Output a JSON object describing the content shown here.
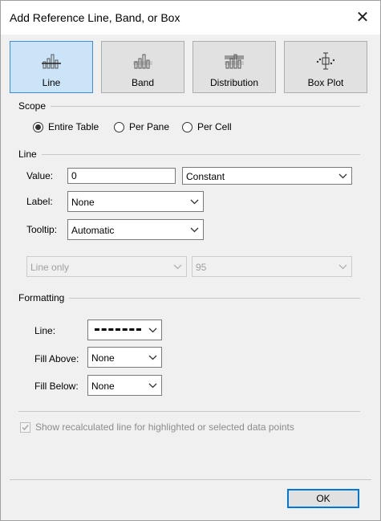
{
  "dialog": {
    "title": "Add Reference Line, Band, or Box",
    "tabs": [
      {
        "label": "Line",
        "icon": "reference-line-icon",
        "selected": true
      },
      {
        "label": "Band",
        "icon": "reference-band-icon",
        "selected": false
      },
      {
        "label": "Distribution",
        "icon": "distribution-icon",
        "selected": false
      },
      {
        "label": "Box Plot",
        "icon": "box-plot-icon",
        "selected": false
      }
    ],
    "scope": {
      "heading": "Scope",
      "options": [
        {
          "label": "Entire Table",
          "checked": true
        },
        {
          "label": "Per Pane",
          "checked": false
        },
        {
          "label": "Per Cell",
          "checked": false
        }
      ]
    },
    "line": {
      "heading": "Line",
      "value_label": "Value:",
      "value": "0",
      "value_type": "Constant",
      "label_label": "Label:",
      "label_value": "None",
      "tooltip_label": "Tooltip:",
      "tooltip_value": "Automatic",
      "confidence_type": "Line only",
      "confidence_value": "95"
    },
    "formatting": {
      "heading": "Formatting",
      "line_label": "Line:",
      "fill_above_label": "Fill Above:",
      "fill_above_value": "None",
      "fill_below_label": "Fill Below:",
      "fill_below_value": "None"
    },
    "recalc_checkbox": {
      "label": "Show recalculated line for highlighted or selected data points",
      "checked": true,
      "disabled": true
    },
    "ok_label": "OK"
  },
  "colors": {
    "selected_tab_bg": "#cce4f7",
    "selected_tab_border": "#3d8ee0",
    "dialog_bg": "#f0f0f0",
    "ok_border": "#0078d7"
  }
}
